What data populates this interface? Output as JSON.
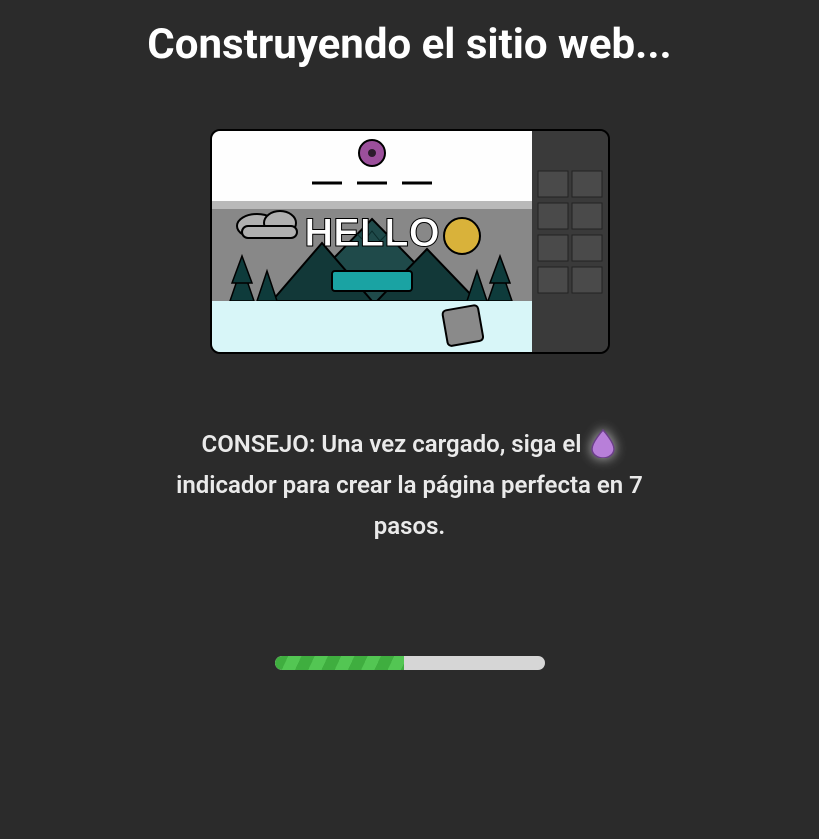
{
  "title": "Construyendo el sitio web...",
  "illustration": {
    "hello_text": "HELLO"
  },
  "tip": {
    "line1": "CONSEJO: Una vez cargado, siga el",
    "line2": "indicador para crear la página perfecta en 7 pasos."
  },
  "progress": {
    "percent": 48
  },
  "colors": {
    "accent_purple": "#b87fd9",
    "progress_green": "#3fae3f"
  }
}
